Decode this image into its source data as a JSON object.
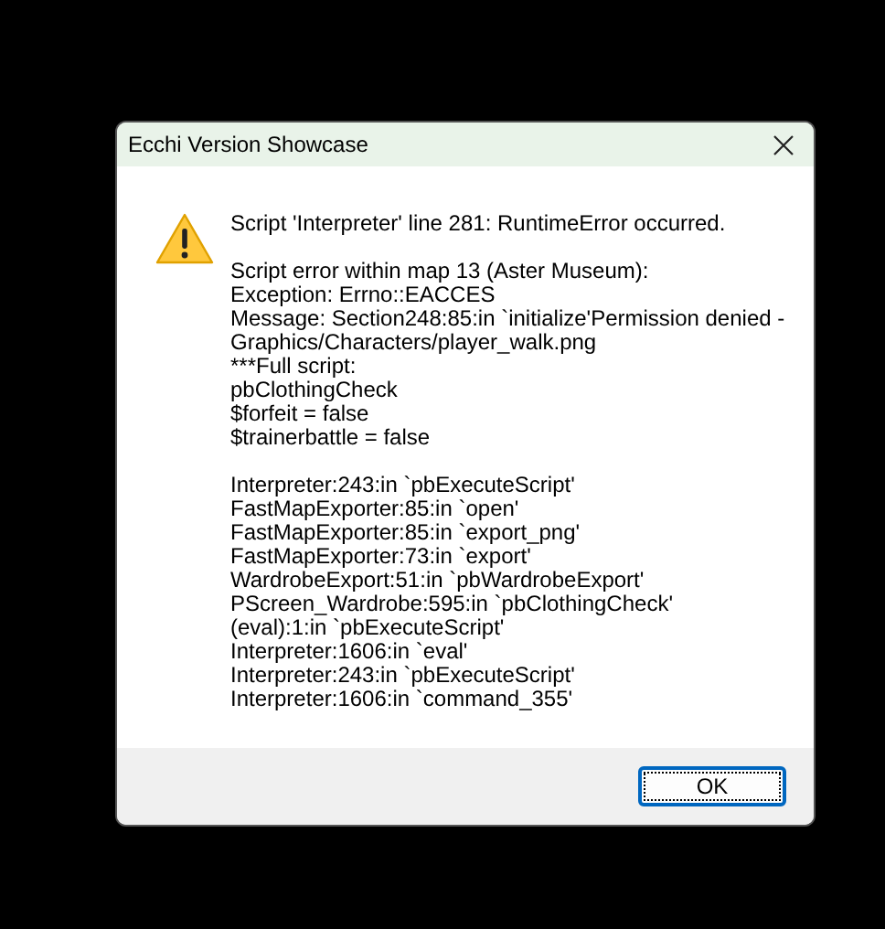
{
  "window": {
    "title": "Ecchi Version Showcase"
  },
  "message_blocks": [
    [
      "Script 'Interpreter' line 281: RuntimeError occurred."
    ],
    [
      "Script error within map 13 (Aster Museum):",
      "Exception: Errno::EACCES",
      "Message: Section248:85:in `initialize'Permission denied -",
      "Graphics/Characters/player_walk.png",
      "***Full script:",
      "pbClothingCheck",
      "$forfeit = false",
      "$trainerbattle = false"
    ],
    [
      "Interpreter:243:in `pbExecuteScript'",
      "FastMapExporter:85:in `open'",
      "FastMapExporter:85:in `export_png'",
      "FastMapExporter:73:in `export'",
      "WardrobeExport:51:in `pbWardrobeExport'",
      "PScreen_Wardrobe:595:in `pbClothingCheck'",
      "(eval):1:in `pbExecuteScript'",
      "Interpreter:1606:in `eval'",
      "Interpreter:243:in `pbExecuteScript'",
      "Interpreter:1606:in `command_355'"
    ]
  ],
  "buttons": [
    "OK"
  ]
}
